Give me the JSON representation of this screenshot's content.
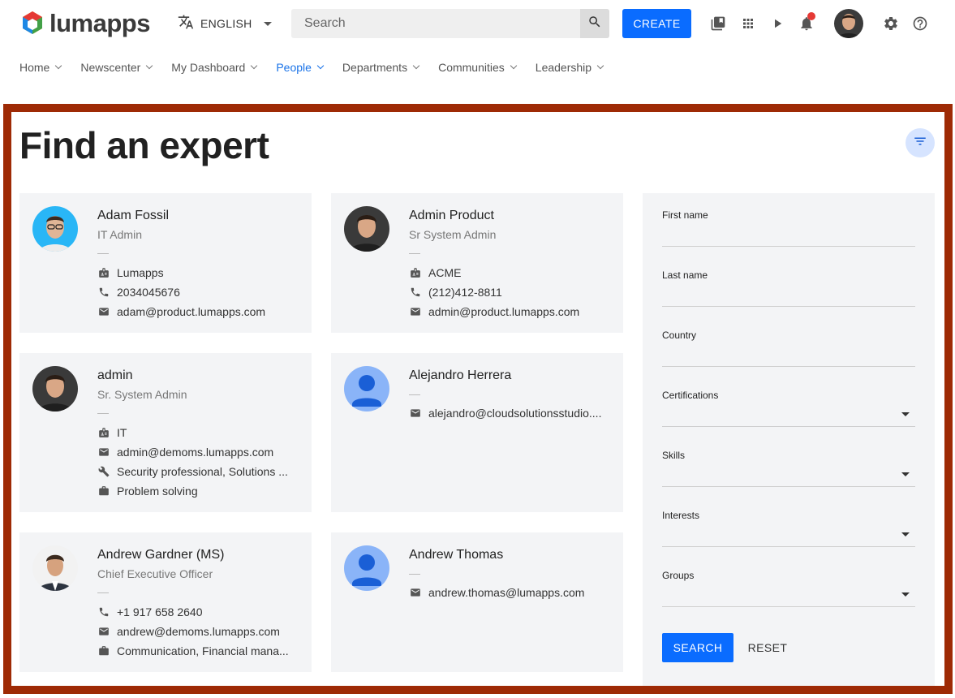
{
  "header": {
    "app_name": "lumapps",
    "language": "ENGLISH",
    "search_placeholder": "Search",
    "create_label": "CREATE"
  },
  "nav": {
    "items": [
      {
        "label": "Home"
      },
      {
        "label": "Newscenter"
      },
      {
        "label": "My Dashboard"
      },
      {
        "label": "People"
      },
      {
        "label": "Departments"
      },
      {
        "label": "Communities"
      },
      {
        "label": "Leadership"
      }
    ]
  },
  "page": {
    "title": "Find an expert"
  },
  "people": [
    {
      "name": "Adam Fossil",
      "job": "IT Admin",
      "org": "Lumapps",
      "phone": "2034045676",
      "email": "adam@product.lumapps.com"
    },
    {
      "name": "Admin Product",
      "job": "Sr System Admin",
      "org": "ACME",
      "phone": "(212)412-8811",
      "email": "admin@product.lumapps.com"
    },
    {
      "name": "admin",
      "job": "Sr. System Admin",
      "org": "IT",
      "email": "admin@demoms.lumapps.com",
      "skills": "Security professional, Solutions ...",
      "interests": "Problem solving"
    },
    {
      "name": "Alejandro Herrera",
      "email": "alejandro@cloudsolutionsstudio...."
    },
    {
      "name": "Andrew Gardner (MS)",
      "job": "Chief Executive Officer",
      "phone": "+1 917 658 2640",
      "email": "andrew@demoms.lumapps.com",
      "interests": "Communication, Financial mana..."
    },
    {
      "name": "Andrew Thomas",
      "email": "andrew.thomas@lumapps.com"
    }
  ],
  "filters": {
    "fields": [
      {
        "label": "First name",
        "type": "text"
      },
      {
        "label": "Last name",
        "type": "text"
      },
      {
        "label": "Country",
        "type": "text"
      },
      {
        "label": "Certifications",
        "type": "select"
      },
      {
        "label": "Skills",
        "type": "select"
      },
      {
        "label": "Interests",
        "type": "select"
      },
      {
        "label": "Groups",
        "type": "select"
      }
    ],
    "search_label": "SEARCH",
    "reset_label": "RESET"
  },
  "colors": {
    "accent": "#0a6cff",
    "active_nav": "#1a73e8",
    "frame": "#9e2a05",
    "card_bg": "#f3f4f6"
  }
}
